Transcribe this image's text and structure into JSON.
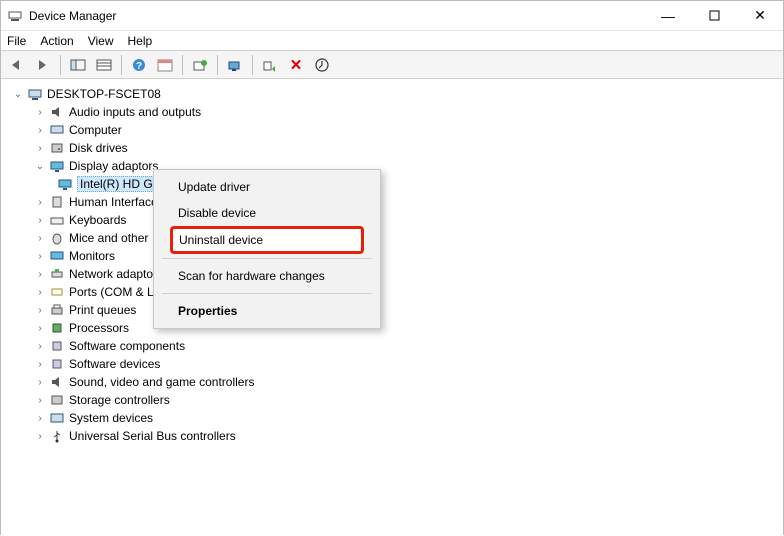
{
  "window": {
    "title": "Device Manager"
  },
  "menu": {
    "file": "File",
    "action": "Action",
    "view": "View",
    "help": "Help"
  },
  "tree": {
    "root": "DESKTOP-FSCET08",
    "items": [
      {
        "label": "Audio inputs and outputs",
        "icon": "audio"
      },
      {
        "label": "Computer",
        "icon": "pc"
      },
      {
        "label": "Disk drives",
        "icon": "disk"
      },
      {
        "label": "Display adaptors",
        "icon": "monitor",
        "expanded": true,
        "children": [
          {
            "label": "Intel(R) HD Graphics 510",
            "icon": "monitor"
          }
        ]
      },
      {
        "label": "Human Interface Devices",
        "icon": "hid"
      },
      {
        "label": "Keyboards",
        "icon": "keyboard"
      },
      {
        "label": "Mice and other pointing devices",
        "icon": "mouse"
      },
      {
        "label": "Monitors",
        "icon": "monitor"
      },
      {
        "label": "Network adaptors",
        "icon": "net"
      },
      {
        "label": "Ports (COM & LPT)",
        "icon": "port"
      },
      {
        "label": "Print queues",
        "icon": "printer"
      },
      {
        "label": "Processors",
        "icon": "cpu"
      },
      {
        "label": "Software components",
        "icon": "comp"
      },
      {
        "label": "Software devices",
        "icon": "comp"
      },
      {
        "label": "Sound, video and game controllers",
        "icon": "audio"
      },
      {
        "label": "Storage controllers",
        "icon": "storage"
      },
      {
        "label": "System devices",
        "icon": "sys"
      },
      {
        "label": "Universal Serial Bus controllers",
        "icon": "usb"
      }
    ]
  },
  "context_menu": {
    "update": "Update driver",
    "disable": "Disable device",
    "uninstall": "Uninstall device",
    "scan": "Scan for hardware changes",
    "properties": "Properties"
  }
}
